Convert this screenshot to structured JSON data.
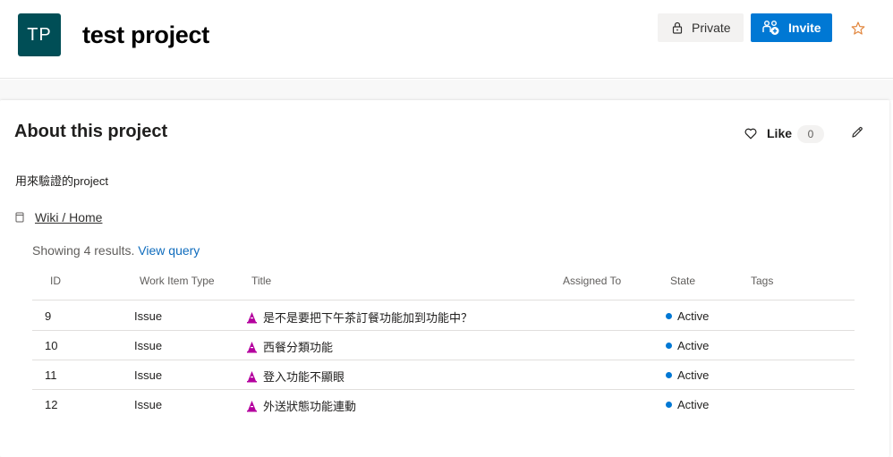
{
  "header": {
    "avatar_initials": "TP",
    "project_name": "test project",
    "private_label": "Private",
    "invite_label": "Invite",
    "brand_color": "#0078d4",
    "avatar_color": "#004e56"
  },
  "about": {
    "title": "About this project",
    "like_label": "Like",
    "like_count": "0",
    "description": "用來驗證的project",
    "wiki_link": "Wiki / Home"
  },
  "query": {
    "showing_text": "Showing 4 results.",
    "view_query_label": "View query"
  },
  "table": {
    "columns": [
      "ID",
      "Work Item Type",
      "Title",
      "Assigned To",
      "State",
      "Tags"
    ],
    "rows": [
      {
        "id": "9",
        "type": "Issue",
        "title": "是不是要把下午茶訂餐功能加到功能中？",
        "assigned": "",
        "state": "Active",
        "tags": ""
      },
      {
        "id": "10",
        "type": "Issue",
        "title": "西餐分類功能",
        "assigned": "",
        "state": "Active",
        "tags": ""
      },
      {
        "id": "11",
        "type": "Issue",
        "title": "登入功能不顯眼",
        "assigned": "",
        "state": "Active",
        "tags": ""
      },
      {
        "id": "12",
        "type": "Issue",
        "title": "外送狀態功能連動",
        "assigned": "",
        "state": "Active",
        "tags": ""
      }
    ]
  }
}
